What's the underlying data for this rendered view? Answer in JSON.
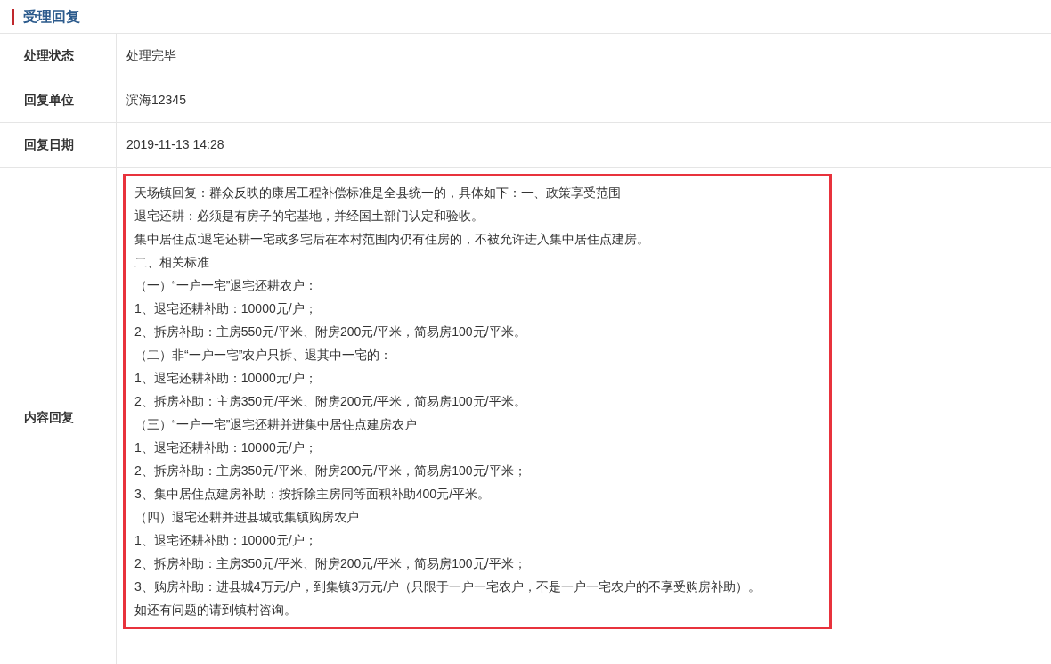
{
  "section": {
    "title": "受理回复"
  },
  "rows": [
    {
      "label": "处理状态",
      "value": "处理完毕"
    },
    {
      "label": "回复单位",
      "value": "滨海12345"
    },
    {
      "label": "回复日期",
      "value": "2019-11-13 14:28"
    }
  ],
  "content": {
    "label": "内容回复",
    "highlighted": true,
    "lines": [
      "天场镇回复：群众反映的康居工程补偿标准是全县统一的，具体如下：一、政策享受范围",
      "退宅还耕：必须是有房子的宅基地，并经国土部门认定和验收。",
      "集中居住点:退宅还耕一宅或多宅后在本村范围内仍有住房的，不被允许进入集中居住点建房。",
      "二、相关标准",
      "（一）“一户一宅”退宅还耕农户：",
      "1、退宅还耕补助：10000元/户；",
      "2、拆房补助：主房550元/平米、附房200元/平米，简易房100元/平米。",
      "（二）非“一户一宅”农户只拆、退其中一宅的：",
      "1、退宅还耕补助：10000元/户；",
      "2、拆房补助：主房350元/平米、附房200元/平米，简易房100元/平米。",
      "（三）“一户一宅”退宅还耕并进集中居住点建房农户",
      "1、退宅还耕补助：10000元/户；",
      "2、拆房补助：主房350元/平米、附房200元/平米，简易房100元/平米；",
      "3、集中居住点建房补助：按拆除主房同等面积补助400元/平米。",
      "（四）退宅还耕并进县城或集镇购房农户",
      "1、退宅还耕补助：10000元/户；",
      "2、拆房补助：主房350元/平米、附房200元/平米，简易房100元/平米；",
      "3、购房补助：进县城4万元/户，到集镇3万元/户（只限于一户一宅农户，不是一户一宅农户的不享受购房补助）。",
      "如还有问题的请到镇村咨询。"
    ]
  }
}
